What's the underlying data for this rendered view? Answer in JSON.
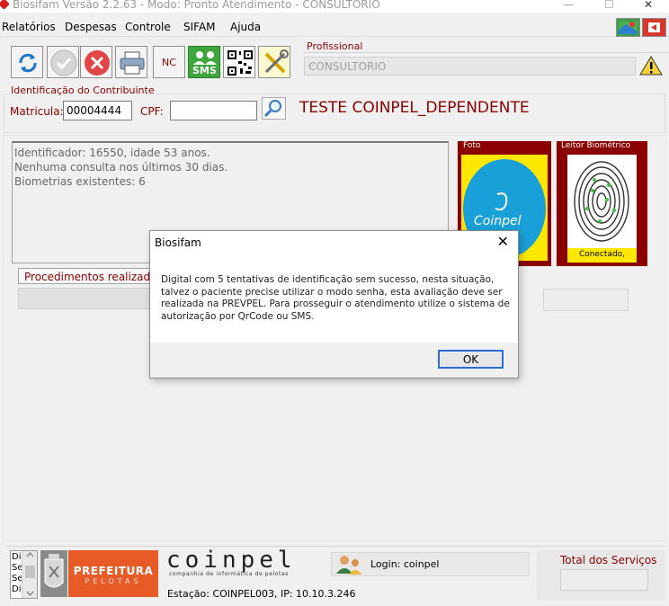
{
  "window": {
    "title": "Biosifam Versão 2.2.63 - Modo: Pronto Atendimento - CONSULTORIO",
    "minimize_glyph": "—",
    "maximize_glyph": "☐",
    "close_glyph": "✕"
  },
  "menu": {
    "items": [
      "Relatórios",
      "Despesas",
      "Controle",
      "SIFAM",
      "Ajuda"
    ]
  },
  "toolbar": {
    "nc_label": "NC",
    "sms_label": "SMS"
  },
  "profissional": {
    "label": "Profissional",
    "selected": "CONSULTORIO"
  },
  "identificacao": {
    "label": "Identificação do Contribuinte",
    "matricula_label": "Matricula:",
    "matricula_value": "00004444",
    "cpf_label": "CPF:",
    "cpf_value": "",
    "patient_name": "TESTE COINPEL_DEPENDENTE"
  },
  "info": {
    "lines": [
      "Identificador: 16550, idade 53 anos.",
      "Nenhuma consulta nos últimos 30 dias.",
      "Biometrias existentes: 6"
    ]
  },
  "foto": {
    "label": "Foto",
    "logo_text": "Coinpel"
  },
  "leitor": {
    "label": "Leitor Biométrico",
    "status": "Conectado,"
  },
  "procedimentos": {
    "tab_label": "Procedimentos realizados"
  },
  "dialog": {
    "title": "Biosifam",
    "message": "Digital com 5 tentativas de identificação sem sucesso, nesta situação, talvez o paciente precise utilizar o modo senha, esta avaliação deve ser realizada na PREVPEL. Para prosseguir o atendimento utilize o sistema de autorização por QrCode ou SMS.",
    "ok_label": "OK",
    "close_glyph": "✕"
  },
  "status": {
    "mini_list": [
      "Di",
      "Se",
      "Se",
      "Di"
    ],
    "prefeitura_line1": "PREFEITURA",
    "prefeitura_line2": "PELOTAS",
    "coinpel_logo": "coinpel",
    "coinpel_subtitle": "companhia de informática de pelotas",
    "estacao": "Estação: COINPEL003, IP: 10.10.3.246",
    "login": "Login: coinpel",
    "total_label": "Total dos Serviços",
    "total_value": ""
  }
}
